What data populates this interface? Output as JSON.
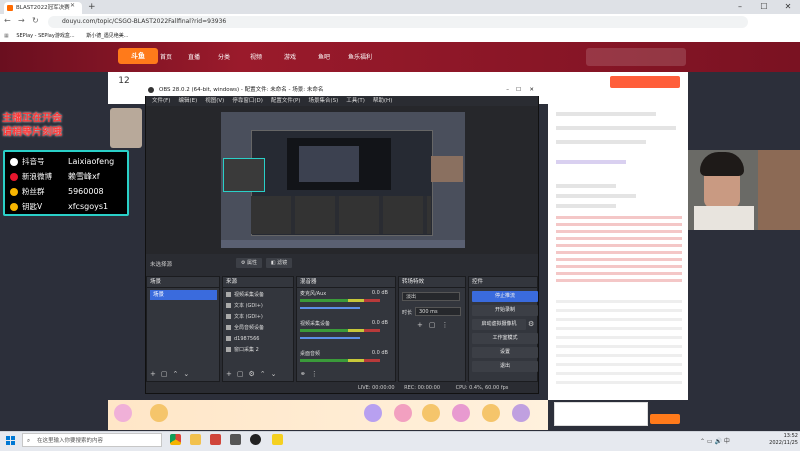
{
  "browser": {
    "tab_title": "BLAST2022冠军决赛",
    "url": "douyu.com/topic/CSGO-BLAST2022Fallfinal?rid=93936",
    "bookmarks": [
      "SEPlay - SEPlay游戏盒...",
      "斯小德_遇见绝美..."
    ]
  },
  "site": {
    "logo": "斗鱼",
    "nav": [
      "首页",
      "直播",
      "分类",
      "视频",
      "游戏",
      "鱼吧",
      "鱼乐福利"
    ],
    "live_count": "12",
    "overlay_title_line1": "主播正在开会",
    "overlay_title_line2": "请稍等片刻哦"
  },
  "social": [
    {
      "platform": "抖音号",
      "value": "Laixiaofeng",
      "icon_color": "#ffffff"
    },
    {
      "platform": "新浪微博",
      "value": "赖雪峰xf",
      "icon_color": "#e6162d"
    },
    {
      "platform": "粉丝群",
      "value": "5960008",
      "icon_color": "#f7b500"
    },
    {
      "platform": "钥匙V",
      "value": "xfcsgoys1",
      "icon_color": "#f7b500"
    }
  ],
  "obs": {
    "title": "OBS 28.0.2 (64-bit, windows) - 配置文件: 未命名 - 场景: 未命名",
    "menu": [
      "文件(F)",
      "编辑(E)",
      "视图(V)",
      "停靠窗口(D)",
      "配置文件(P)",
      "场景集合(S)",
      "工具(T)",
      "帮助(H)"
    ],
    "no_source": "未选择源",
    "btn_properties": "属性",
    "btn_filters": "滤镜",
    "docks": {
      "scenes": "场景",
      "sources": "来源",
      "mixer": "混音器",
      "transitions": "转场特效",
      "controls": "控件"
    },
    "scene_list": [
      "场景"
    ],
    "sources": [
      "视频采集设备",
      "文本 (GDI+)",
      "文本 (GDI+)",
      "全局音频设备",
      "d1987566",
      "窗口采集 2"
    ],
    "mixer": [
      {
        "name": "麦克风/Aux",
        "db": "0.0 dB"
      },
      {
        "name": "视频采集设备",
        "db": "0.0 dB"
      },
      {
        "name": "桌面音频",
        "db": "0.0 dB"
      }
    ],
    "transition_type": "淡出",
    "duration_label": "时长",
    "duration_value": "300 ms",
    "controls": [
      "停止推流",
      "开始录制",
      "启动虚拟摄像机",
      "工作室模式",
      "设置",
      "退出"
    ],
    "status_live": "LIVE: 00:00:00",
    "status_rec": "REC: 00:00:00",
    "status_cpu": "CPU: 0.4%, 60.00 fps"
  },
  "taskbar": {
    "search_placeholder": "在这里输入你要搜索的内容",
    "time": "13:52",
    "date": "2022/11/25"
  },
  "colors": {
    "accent": "#3a6bdd",
    "douyu_orange": "#ff7a1a",
    "social_border": "#2ad0c8",
    "overlay_red": "#ff3838"
  }
}
